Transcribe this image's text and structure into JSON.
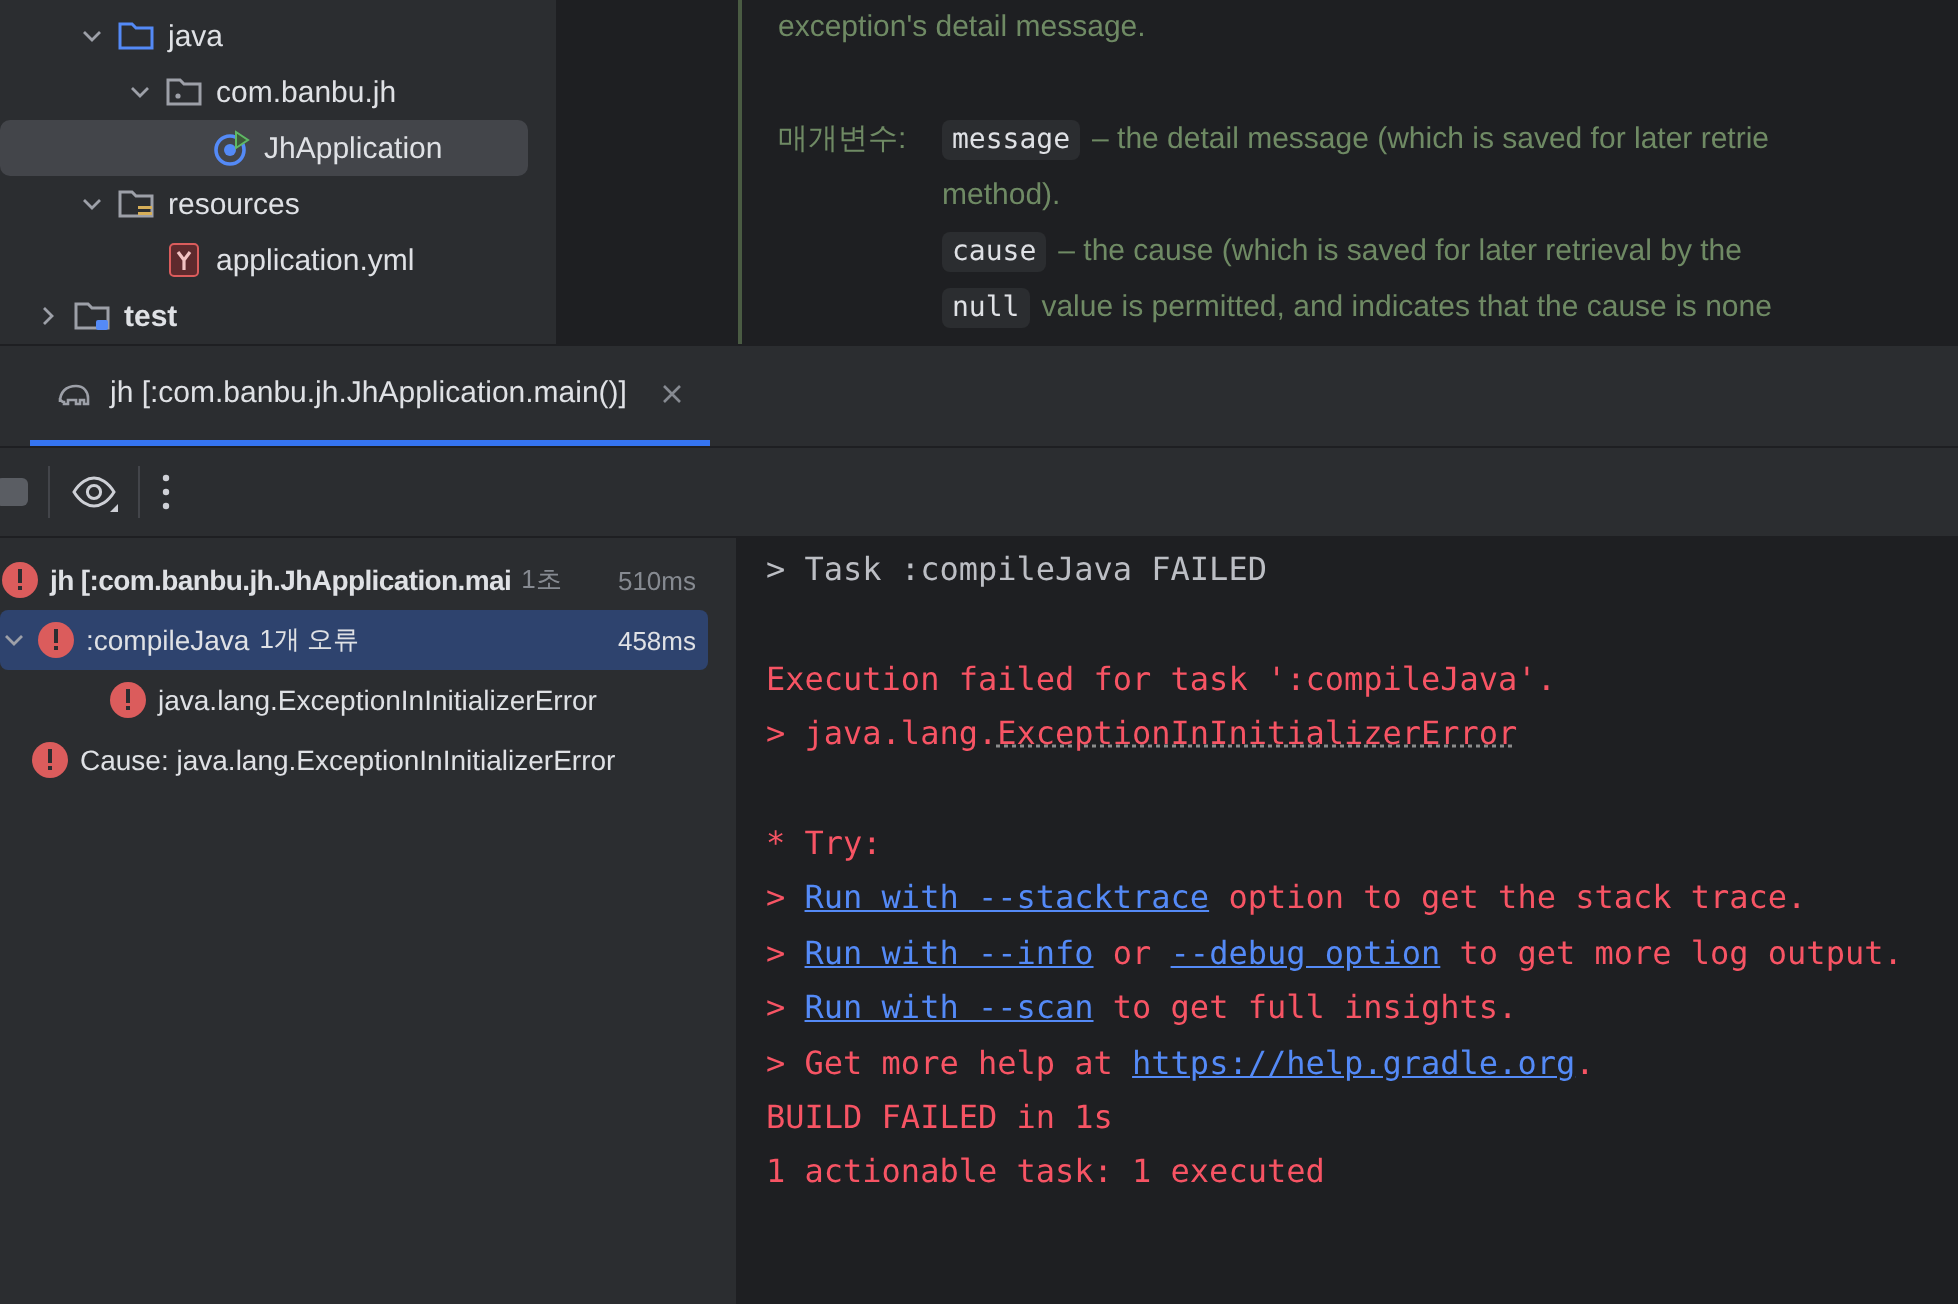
{
  "project_tree": [
    {
      "label": "java",
      "kind": "folder",
      "expanded": true,
      "selected": false
    },
    {
      "label": "com.banbu.jh",
      "kind": "package",
      "expanded": true,
      "selected": false
    },
    {
      "label": "JhApplication",
      "kind": "app",
      "selected": true
    },
    {
      "label": "resources",
      "kind": "resources",
      "expanded": true,
      "selected": false
    },
    {
      "label": "application.yml",
      "kind": "yaml",
      "selected": false
    },
    {
      "label": "test",
      "kind": "testfolder",
      "expanded": false,
      "selected": false
    }
  ],
  "doc": {
    "intro": "exception's detail message.",
    "params_label": "매개변수:",
    "params": [
      {
        "code": "message",
        "text": "– the detail message (which is saved for later retrie",
        "cont": "method)."
      },
      {
        "code": "cause",
        "text": "– the cause (which is saved for later retrieval by the"
      },
      {
        "code": "null",
        "text": "value is permitted, and indicates that the cause is none"
      }
    ]
  },
  "run_tabs": [
    {
      "label": "jh [:com.banbu.jh.JhApplication.main()]",
      "selected": true
    }
  ],
  "build_tree": [
    {
      "label": "jh [:com.banbu.jh.JhApplication.mai",
      "bold": true,
      "badge": "1초",
      "time": "510ms",
      "selected": false,
      "children": [
        {
          "label": ":compileJava",
          "bold": false,
          "badge": "1개 오류",
          "time": "458ms",
          "selected": true,
          "expanded": true,
          "children": [
            {
              "label": "java.lang.ExceptionInInitializerError",
              "bold": false,
              "selected": false
            }
          ]
        },
        {
          "label": "Cause: java.lang.ExceptionInInitializerError",
          "bold": false,
          "selected": false
        }
      ]
    }
  ],
  "console": [
    {
      "kind": "info",
      "parts": [
        {
          "kind": "plain",
          "text": "> Task :compileJava FAILED"
        }
      ]
    },
    {
      "kind": "blank"
    },
    {
      "kind": "error",
      "parts": [
        {
          "kind": "plain",
          "text": "Execution failed for task ':compileJava'."
        }
      ]
    },
    {
      "kind": "error",
      "parts": [
        {
          "kind": "plain",
          "text": "> java.lang."
        },
        {
          "kind": "dotted",
          "text": "ExceptionInInitializerError"
        }
      ]
    },
    {
      "kind": "blank"
    },
    {
      "kind": "error",
      "parts": [
        {
          "kind": "plain",
          "text": "* Try:"
        }
      ]
    },
    {
      "kind": "error",
      "parts": [
        {
          "kind": "plain",
          "text": "> "
        },
        {
          "kind": "link",
          "text": "Run with --stacktrace"
        },
        {
          "kind": "plain",
          "text": " option to get the stack trace."
        }
      ]
    },
    {
      "kind": "error",
      "parts": [
        {
          "kind": "plain",
          "text": "> "
        },
        {
          "kind": "link",
          "text": "Run with --info"
        },
        {
          "kind": "plain",
          "text": " or "
        },
        {
          "kind": "link",
          "text": "--debug option"
        },
        {
          "kind": "plain",
          "text": " to get more log output."
        }
      ]
    },
    {
      "kind": "error",
      "parts": [
        {
          "kind": "plain",
          "text": "> "
        },
        {
          "kind": "link",
          "text": "Run with --scan"
        },
        {
          "kind": "plain",
          "text": " to get full insights."
        }
      ]
    },
    {
      "kind": "error",
      "parts": [
        {
          "kind": "plain",
          "text": "> Get more help at "
        },
        {
          "kind": "link",
          "text": "https://help.gradle.org"
        },
        {
          "kind": "plain",
          "text": "."
        }
      ]
    },
    {
      "kind": "error",
      "parts": [
        {
          "kind": "plain",
          "text": "BUILD FAILED in 1s"
        }
      ]
    },
    {
      "kind": "error",
      "parts": [
        {
          "kind": "plain",
          "text": "1 actionable task: 1 executed"
        }
      ]
    }
  ]
}
